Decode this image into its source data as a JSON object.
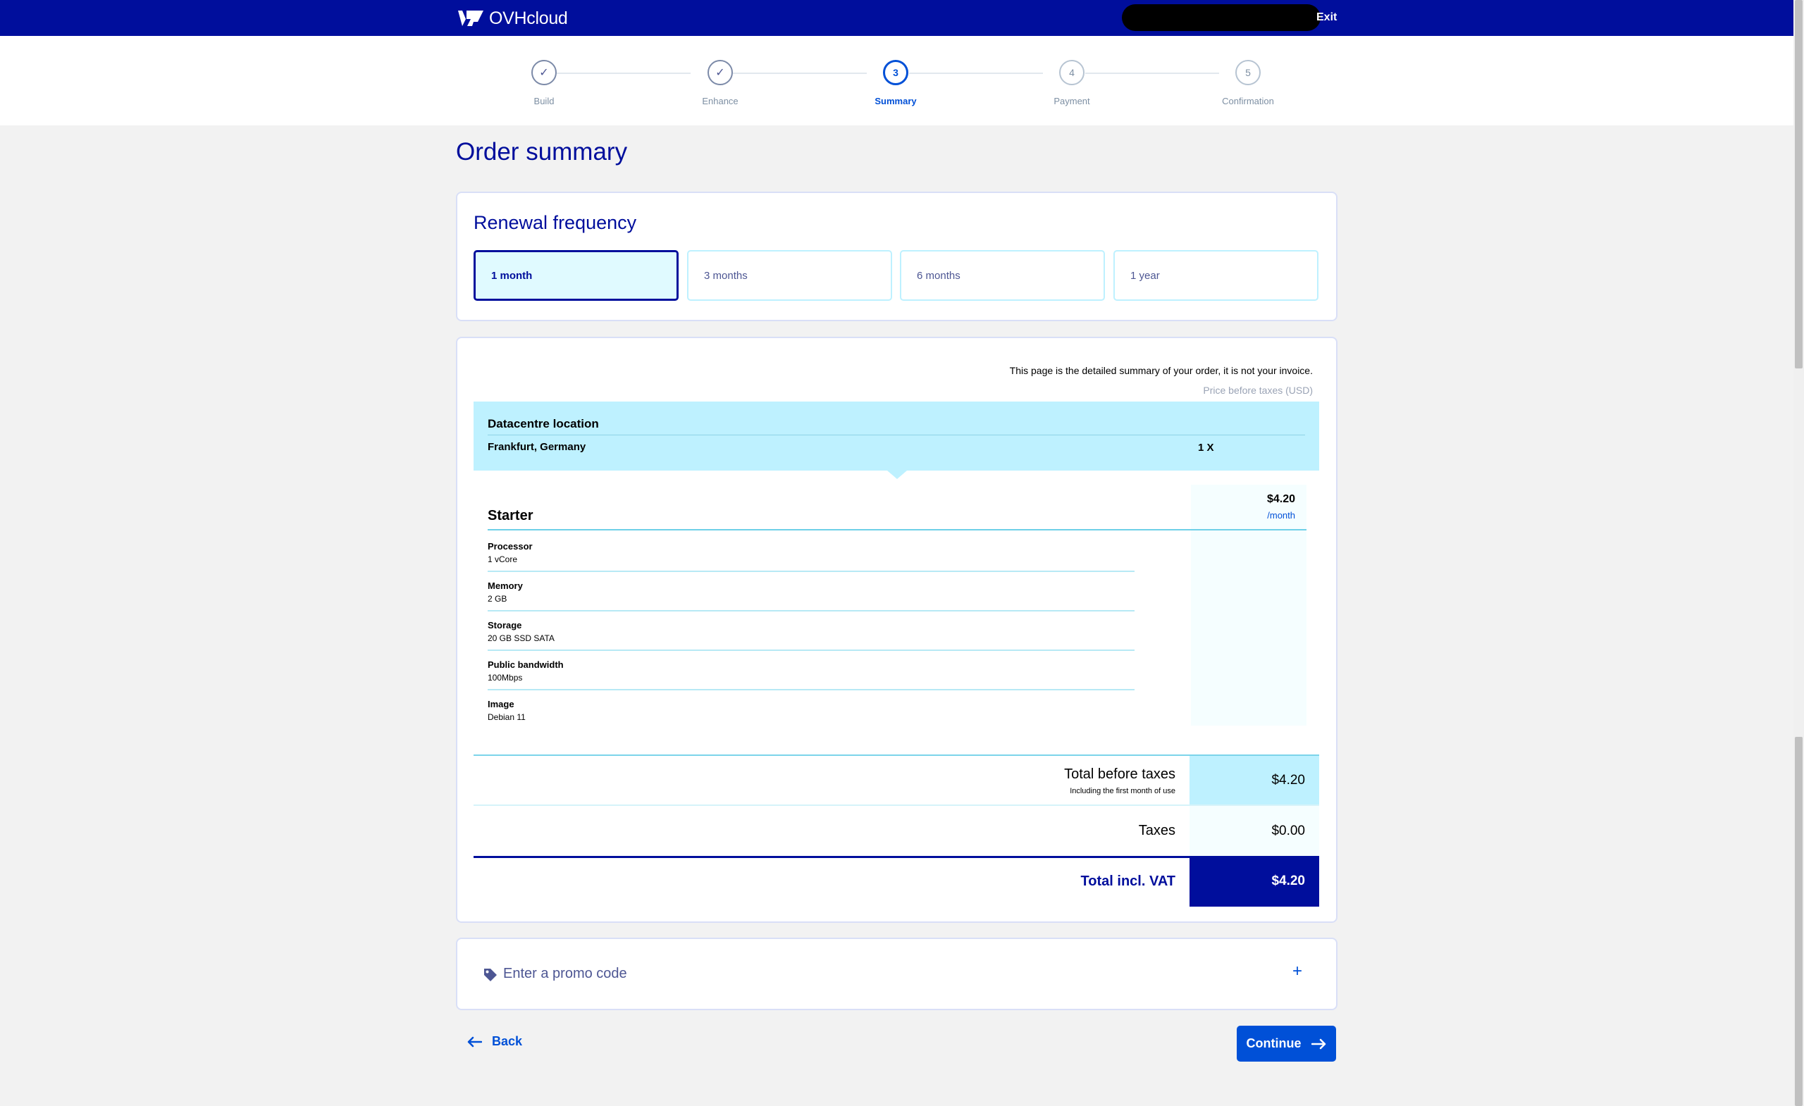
{
  "header": {
    "brand": "OVHcloud",
    "exit_label": "Exit"
  },
  "stepper": {
    "steps": [
      {
        "label": "Build",
        "marker": "✓",
        "state": "done"
      },
      {
        "label": "Enhance",
        "marker": "✓",
        "state": "done"
      },
      {
        "label": "Summary",
        "marker": "3",
        "state": "active"
      },
      {
        "label": "Payment",
        "marker": "4",
        "state": "upcoming"
      },
      {
        "label": "Confirmation",
        "marker": "5",
        "state": "upcoming"
      }
    ]
  },
  "page": {
    "title": "Order summary"
  },
  "renewal": {
    "title": "Renewal frequency",
    "options": [
      "1 month",
      "3 months",
      "6 months",
      "1 year"
    ],
    "selected": "1 month"
  },
  "summary": {
    "note": "This page is the detailed summary of your order, it is not your invoice.",
    "price_note": "Price before taxes (USD)",
    "datacentre": {
      "title": "Datacentre location",
      "value": "Frankfurt, Germany",
      "quantity": "1 X"
    },
    "plan": {
      "name": "Starter",
      "price": "$4.20",
      "period": "/month",
      "specs": [
        {
          "label": "Processor",
          "value": "1 vCore"
        },
        {
          "label": "Memory",
          "value": "2 GB"
        },
        {
          "label": "Storage",
          "value": "20 GB SSD SATA"
        },
        {
          "label": "Public bandwidth",
          "value": "100Mbps"
        },
        {
          "label": "Image",
          "value": "Debian 11"
        }
      ]
    },
    "totals": {
      "before_taxes_label": "Total before taxes",
      "before_taxes_sub": "Including the first month of use",
      "before_taxes_amount": "$4.20",
      "taxes_label": "Taxes",
      "taxes_amount": "$0.00",
      "incl_vat_label": "Total incl. VAT",
      "incl_vat_amount": "$4.20"
    }
  },
  "promo": {
    "label": "Enter a promo code",
    "icon": "tag-icon",
    "expand_symbol": "+"
  },
  "actions": {
    "back_label": "Back",
    "continue_label": "Continue"
  },
  "colors": {
    "brand": "#000e9c",
    "accent": "#0050d7",
    "highlight": "#bef1ff"
  }
}
